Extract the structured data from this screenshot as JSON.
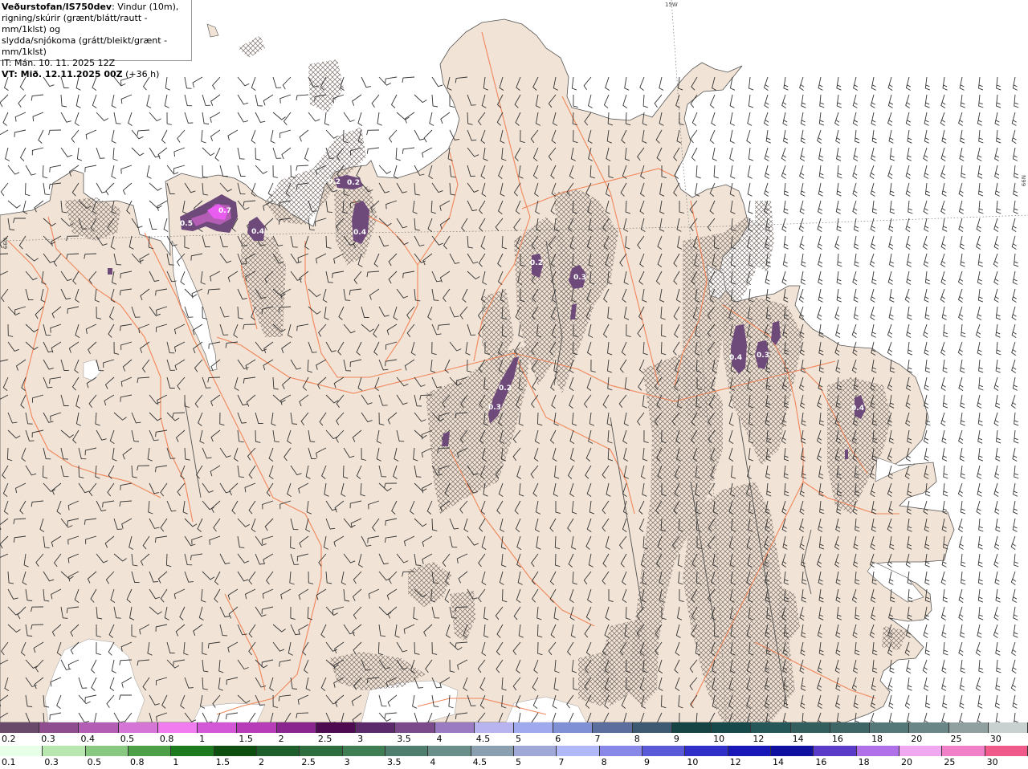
{
  "header": {
    "title": "Veðurstofan/IS750dev",
    "subtitle_line1": ": Vindur (10m),",
    "subtitle_line2": "rigning/skúrir (grænt/blátt/rautt - mm/1klst) og",
    "subtitle_line3": "slydda/snjókoma (grátt/bleikt/grænt - mm/1klst)",
    "issue_time": "IT: Mán. 10. 11. 2025 12Z",
    "valid_time": "VT: Mið. 12.11.2025 00Z",
    "lead_time": "(+36 h)"
  },
  "grid_labels": {
    "top": "15W",
    "right": "N99",
    "left": "N99"
  },
  "colors": {
    "land": "#f1e3d5",
    "sea": "#ffffff",
    "roads": "#f2865a",
    "rivers": "#555555",
    "hatch": "#7a6f6a",
    "wind_barb": "#333333",
    "precip_light": "#6e4a7a",
    "precip_heavy": "#c050d8",
    "precip_peak": "#e85cf0"
  },
  "precip_labels": [
    {
      "id": "p1",
      "text": "0.5"
    },
    {
      "id": "p2",
      "text": "0.7"
    },
    {
      "id": "p3",
      "text": "0.4"
    },
    {
      "id": "p4",
      "text": "0.2"
    },
    {
      "id": "p5",
      "text": "0.2"
    },
    {
      "id": "p6",
      "text": "0.4"
    },
    {
      "id": "p7",
      "text": "0.2"
    },
    {
      "id": "p8",
      "text": "0.3"
    },
    {
      "id": "p9",
      "text": "0.2"
    },
    {
      "id": "p10",
      "text": "0.3"
    },
    {
      "id": "p11",
      "text": "0.4"
    },
    {
      "id": "p12",
      "text": "0.3"
    },
    {
      "id": "p13",
      "text": "0.4"
    }
  ],
  "legend_snow": {
    "labels": [
      "0.2",
      "0.3",
      "0.4",
      "0.5",
      "0.8",
      "1",
      "1.5",
      "2",
      "2.5",
      "3",
      "3.5",
      "4",
      "4.5",
      "5",
      "6",
      "7",
      "8",
      "9",
      "10",
      "12",
      "14",
      "16",
      "18",
      "20",
      "25",
      "30"
    ],
    "colors": [
      "#6a4a6a",
      "#8e4d8e",
      "#b45db4",
      "#d575d5",
      "#f07cf0",
      "#d258d8",
      "#b63cb8",
      "#8a2590",
      "#4e0a50",
      "#5a2a6a",
      "#7a4a8a",
      "#9a7ac0",
      "#b8b4f0",
      "#a0a8ee",
      "#8090d4",
      "#5c6e9e",
      "#3e5a72",
      "#164444",
      "#164a4a",
      "#245858",
      "#325e5e",
      "#3e6666",
      "#547878",
      "#6a8686",
      "#90a0a0",
      "#c8d0d0",
      "#ffffff"
    ]
  },
  "legend_rain": {
    "labels": [
      "0.1",
      "0.3",
      "0.5",
      "0.8",
      "1",
      "1.5",
      "2",
      "2.5",
      "3",
      "3.5",
      "4",
      "4.5",
      "5",
      "7",
      "8",
      "9",
      "10",
      "12",
      "14",
      "16",
      "18",
      "20",
      "25",
      "30"
    ],
    "colors": [
      "#e8ffe8",
      "#b8e8b0",
      "#88c880",
      "#4ea048",
      "#1e7a1e",
      "#0e4e0e",
      "#1e5e2a",
      "#2e6e3e",
      "#3e7e52",
      "#507e6e",
      "#6a8e8a",
      "#8aa0b0",
      "#a0a8d8",
      "#b0b8f8",
      "#8888e8",
      "#5a5ad8",
      "#3030c8",
      "#1818b8",
      "#1010a0",
      "#5a3cc8",
      "#b070e8",
      "#f0a8f0",
      "#f080c8",
      "#f05a8a",
      "#f03050",
      "#d81818"
    ]
  }
}
